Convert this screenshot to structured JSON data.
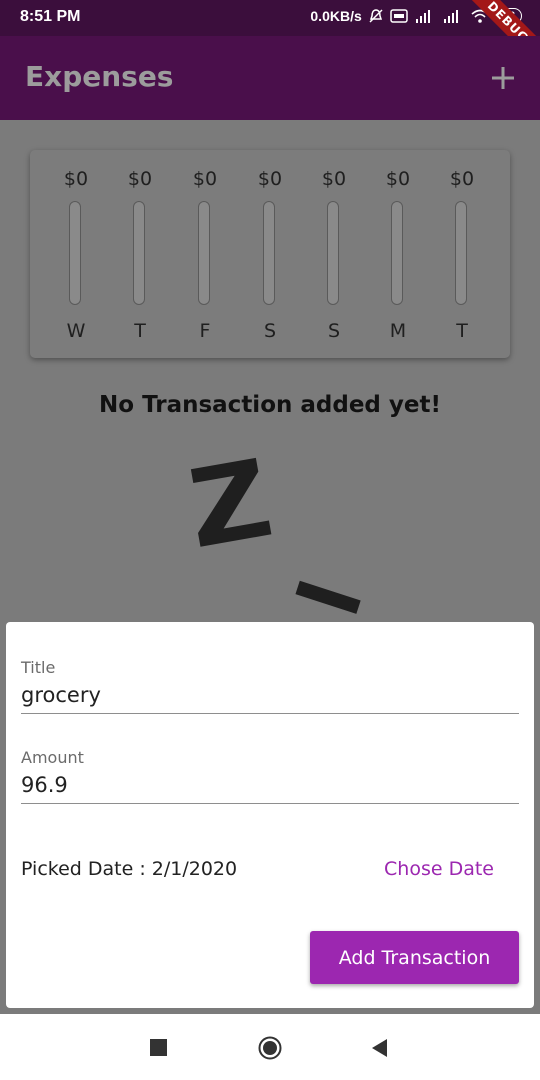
{
  "status_bar": {
    "time": "8:51 PM",
    "network_speed": "0.0KB/s",
    "battery": "93",
    "debug_banner": "DEBUG"
  },
  "app_bar": {
    "title": "Expenses",
    "add_icon": "plus-icon"
  },
  "chart": {
    "bars": [
      {
        "day": "W",
        "amount": "$0",
        "fill_fraction": 0
      },
      {
        "day": "T",
        "amount": "$0",
        "fill_fraction": 0
      },
      {
        "day": "F",
        "amount": "$0",
        "fill_fraction": 0
      },
      {
        "day": "S",
        "amount": "$0",
        "fill_fraction": 0
      },
      {
        "day": "S",
        "amount": "$0",
        "fill_fraction": 0
      },
      {
        "day": "M",
        "amount": "$0",
        "fill_fraction": 0
      },
      {
        "day": "T",
        "amount": "$0",
        "fill_fraction": 0
      }
    ]
  },
  "empty_state": {
    "message": "No Transaction added yet!"
  },
  "form": {
    "title_label": "Title",
    "title_value": "grocery",
    "amount_label": "Amount",
    "amount_value": "96.9",
    "picked_date": "Picked Date : 2/1/2020",
    "chose_date_label": "Chose Date",
    "add_button_label": "Add Transaction"
  },
  "colors": {
    "primary": "#4a0f4b",
    "accent": "#9c27b0"
  }
}
